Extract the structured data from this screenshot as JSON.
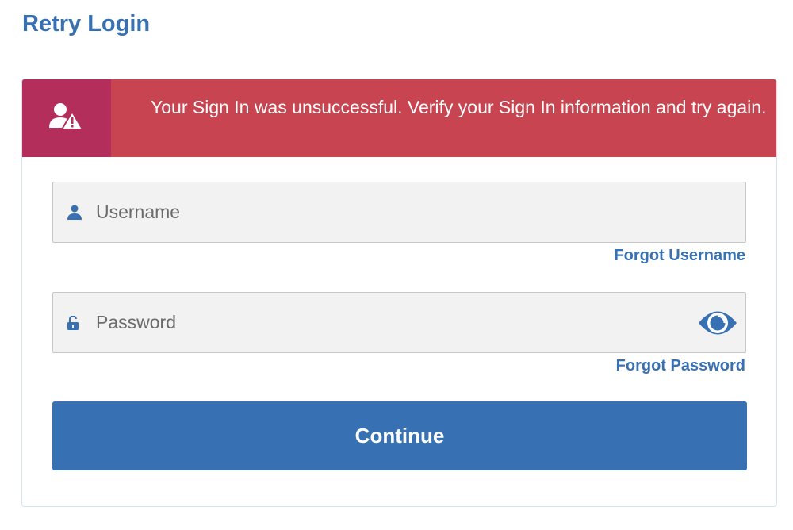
{
  "page": {
    "title": "Retry Login"
  },
  "alert": {
    "icon": "user-warning-icon",
    "message": "Your Sign In was unsuccessful. Verify your Sign In information and try again."
  },
  "username": {
    "icon": "user-icon",
    "placeholder": "Username",
    "value": "",
    "forgot_label": "Forgot Username"
  },
  "password": {
    "icon": "lock-open-icon",
    "placeholder": "Password",
    "value": "",
    "toggle_icon": "eye-icon",
    "forgot_label": "Forgot Password"
  },
  "continue_button": {
    "label": "Continue"
  },
  "colors": {
    "brand_blue": "#3770b3",
    "alert_red": "#c74450",
    "alert_icon_bg": "#b42e5b",
    "field_bg": "#f2f2f2"
  }
}
